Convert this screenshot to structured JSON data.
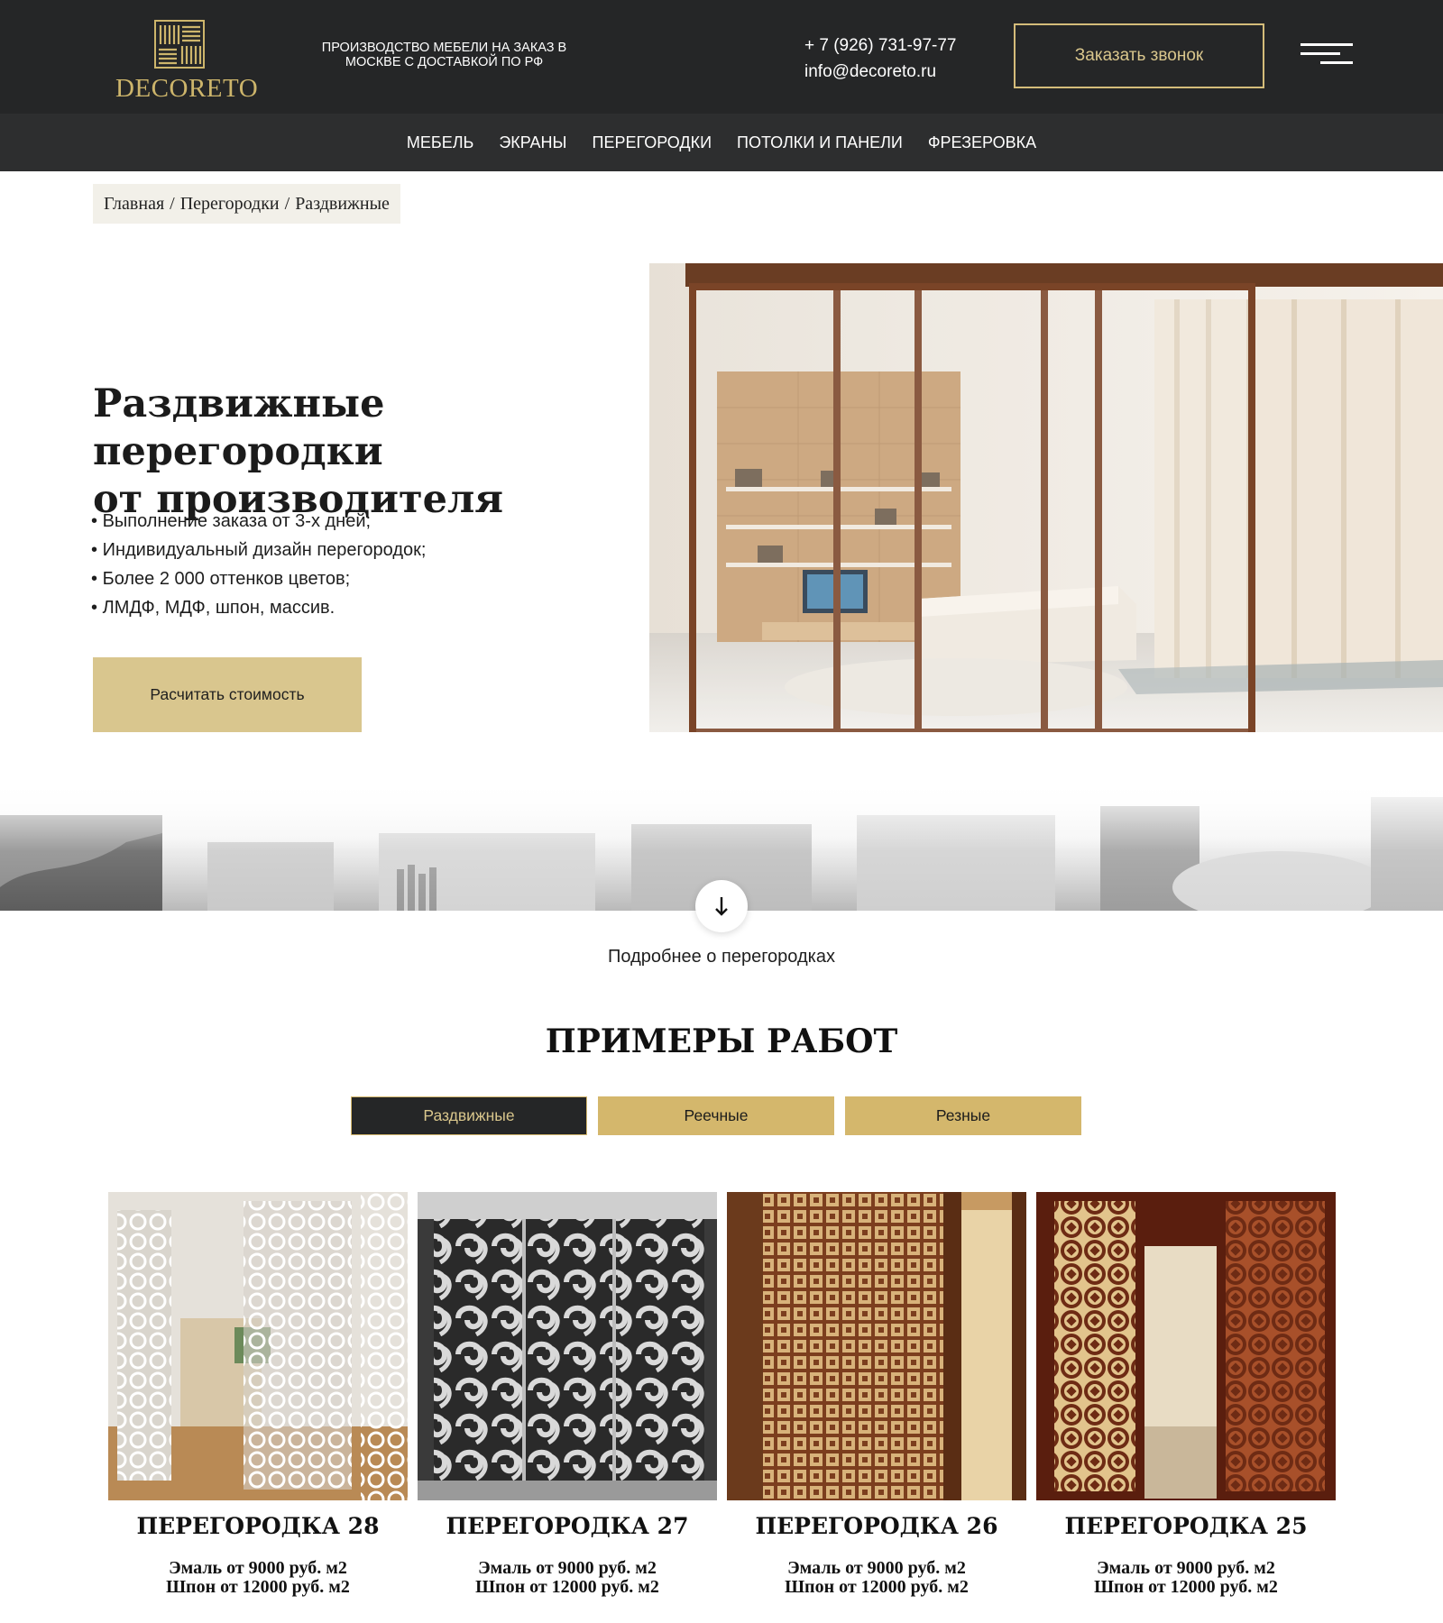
{
  "header": {
    "logo_text": "DECORETO",
    "tagline": "ПРОИЗВОДСТВО МЕБЕЛИ НА ЗАКАЗ В МОСКВЕ С ДОСТАВКОЙ ПО РФ",
    "phone": "+ 7 (926) 731-97-77",
    "email": "info@decoreto.ru",
    "callback_label": "Заказать звонок",
    "menu_icon": "hamburger-icon",
    "accent_color": "#d4bc7a",
    "background_color": "#252627"
  },
  "nav": {
    "items": [
      {
        "label": "МЕБЕЛЬ"
      },
      {
        "label": "ЭКРАНЫ"
      },
      {
        "label": "ПЕРЕГОРОДКИ"
      },
      {
        "label": "ПОТОЛКИ И ПАНЕЛИ"
      },
      {
        "label": "ФРЕЗЕРОВКА"
      }
    ]
  },
  "breadcrumb": {
    "items": [
      {
        "label": "Главная"
      },
      {
        "label": "Перегородки"
      },
      {
        "label": "Раздвижные"
      }
    ],
    "separator": "/"
  },
  "hero": {
    "title_line1": "Раздвижные перегородки",
    "title_line2": "от производителя",
    "features": [
      "Выполнение заказа от 3-х дней;",
      "Индивидуальный дизайн перегородок;",
      "Более 2 000 оттенков цветов;",
      "ЛМДФ, МДФ, шпон, массив."
    ],
    "cta_label": "Расчитать стоимость",
    "cta_color": "#d9c68e"
  },
  "more": {
    "icon": "arrow-down-icon",
    "label": "Подробнее о перегородках"
  },
  "works": {
    "title": "ПРИМЕРЫ РАБОТ",
    "tabs": [
      {
        "label": "Раздвижные",
        "active": true
      },
      {
        "label": "Реечные",
        "active": false
      },
      {
        "label": "Резные",
        "active": false
      }
    ],
    "cards": [
      {
        "title": "ПЕРЕГОРОДКА 28",
        "price_line1": "Эмаль от 9000 руб. м2",
        "price_line2": "Шпон от 12000 руб. м2"
      },
      {
        "title": "ПЕРЕГОРОДКА 27",
        "price_line1": "Эмаль от 9000 руб. м2",
        "price_line2": "Шпон от 12000 руб. м2"
      },
      {
        "title": "ПЕРЕГОРОДКА 26",
        "price_line1": "Эмаль от 9000 руб. м2",
        "price_line2": "Шпон от 12000 руб. м2"
      },
      {
        "title": "ПЕРЕГОРОДКА 25",
        "price_line1": "Эмаль от 9000 руб. м2",
        "price_line2": "Шпон от 12000 руб. м2"
      }
    ]
  }
}
